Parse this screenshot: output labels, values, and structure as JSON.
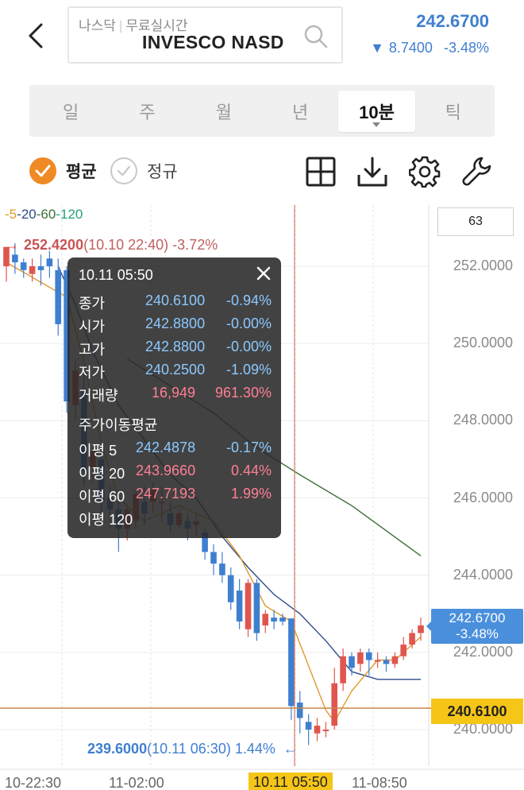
{
  "header": {
    "exchange": "나스닥",
    "realtime": "무료실시간",
    "symbol_name": "INVESCO NASD",
    "price": "242.6700",
    "change_arrow": "▼",
    "change_value": "8.7400",
    "change_percent": "-3.48%",
    "change_color": "#3f7fd0"
  },
  "tabs": [
    {
      "label": "일",
      "active": false
    },
    {
      "label": "주",
      "active": false
    },
    {
      "label": "월",
      "active": false
    },
    {
      "label": "년",
      "active": false
    },
    {
      "label": "10분",
      "active": true
    },
    {
      "label": "틱",
      "active": false
    }
  ],
  "toolbar": {
    "average_label": "평균",
    "average_checked": true,
    "regular_label": "정규",
    "regular_checked": false,
    "icons": [
      "grid-icon",
      "download-icon",
      "settings-icon",
      "wrench-icon"
    ],
    "accent_color": "#f08a24"
  },
  "chart": {
    "ma_legend": {
      "dash": "-",
      "ma5": "5",
      "ma20": "20",
      "ma60": "60",
      "ma120": "120"
    },
    "count": "63",
    "high_label": {
      "arrow": "→",
      "value": "252.4200",
      "time": "(10.10 22:40)",
      "percent": "-3.72%"
    },
    "low_label": {
      "value": "239.6000",
      "time": "(10.11 06:30)",
      "percent": "1.44%",
      "arrow": "←"
    },
    "y_axis": [
      "252.0000",
      "250.0000",
      "248.0000",
      "246.0000",
      "244.0000",
      "242.0000",
      "240.0000"
    ],
    "current_price_tag": {
      "price": "242.6700",
      "percent": "-3.48%"
    },
    "crosshair_price": "240.6100",
    "x_axis": [
      "10-22:30",
      "11-02:00",
      "10.11 05:50",
      "11-08:50"
    ]
  },
  "tooltip": {
    "datetime": "10.11 05:50",
    "rows": [
      {
        "key": "종가",
        "value": "240.6100",
        "pct": "-0.94%"
      },
      {
        "key": "시가",
        "value": "242.8800",
        "pct": "-0.00%"
      },
      {
        "key": "고가",
        "value": "242.8800",
        "pct": "-0.00%"
      },
      {
        "key": "저가",
        "value": "240.2500",
        "pct": "-1.09%"
      }
    ],
    "volume": {
      "key": "거래량",
      "value": "16,949",
      "pct": "961.30%"
    },
    "ma_section_title": "주가이동평균",
    "ma_rows": [
      {
        "key": "이평 5",
        "value": "242.4878",
        "pct": "-0.17%"
      },
      {
        "key": "이평 20",
        "value": "243.9660",
        "pct": "0.44%"
      },
      {
        "key": "이평 60",
        "value": "247.7193",
        "pct": "1.99%"
      },
      {
        "key": "이평 120",
        "value": "",
        "pct": ""
      }
    ]
  },
  "chart_data": {
    "type": "candlestick",
    "y_range": [
      239.2,
      253.0
    ],
    "x_labels": [
      "10-22:30",
      "11-02:00",
      "10.11 05:50",
      "11-08:50"
    ],
    "candles": [
      {
        "o": 252.0,
        "h": 252.5,
        "c": 252.5,
        "l": 251.6
      },
      {
        "o": 252.3,
        "h": 252.6,
        "c": 252.1,
        "l": 251.8
      },
      {
        "o": 252.1,
        "h": 252.2,
        "c": 251.9,
        "l": 251.7
      },
      {
        "o": 251.8,
        "h": 252.2,
        "c": 252.0,
        "l": 251.6
      },
      {
        "o": 252.0,
        "h": 252.3,
        "c": 251.9,
        "l": 251.5
      },
      {
        "o": 252.2,
        "h": 252.4,
        "c": 252.0,
        "l": 251.7
      },
      {
        "o": 251.9,
        "h": 252.2,
        "c": 250.5,
        "l": 250.2
      },
      {
        "o": 251.9,
        "h": 252.0,
        "c": 248.5,
        "l": 248.2
      },
      {
        "o": 248.4,
        "h": 249.6,
        "c": 249.3,
        "l": 248.0
      },
      {
        "o": 248.8,
        "h": 249.2,
        "c": 246.7,
        "l": 246.3
      },
      {
        "o": 246.8,
        "h": 247.3,
        "c": 247.2,
        "l": 246.4
      },
      {
        "o": 247.0,
        "h": 247.3,
        "c": 245.9,
        "l": 245.5
      },
      {
        "o": 246.0,
        "h": 246.3,
        "c": 245.7,
        "l": 245.2
      },
      {
        "o": 245.7,
        "h": 246.0,
        "c": 245.2,
        "l": 244.6
      },
      {
        "o": 245.2,
        "h": 245.8,
        "c": 245.7,
        "l": 244.9
      },
      {
        "o": 245.4,
        "h": 246.2,
        "c": 246.1,
        "l": 245.2
      },
      {
        "o": 245.9,
        "h": 246.3,
        "c": 245.6,
        "l": 245.3
      },
      {
        "o": 245.9,
        "h": 246.4,
        "c": 246.2,
        "l": 245.6
      },
      {
        "o": 245.9,
        "h": 246.3,
        "c": 245.9,
        "l": 245.4
      },
      {
        "o": 245.6,
        "h": 245.9,
        "c": 245.3,
        "l": 245.1
      },
      {
        "o": 245.3,
        "h": 245.7,
        "c": 245.6,
        "l": 245.2
      },
      {
        "o": 245.4,
        "h": 245.6,
        "c": 245.2,
        "l": 244.9
      },
      {
        "o": 245.3,
        "h": 245.6,
        "c": 245.4,
        "l": 245.0
      },
      {
        "o": 245.1,
        "h": 245.2,
        "c": 244.6,
        "l": 244.4
      },
      {
        "o": 244.6,
        "h": 244.8,
        "c": 244.3,
        "l": 244.0
      },
      {
        "o": 244.3,
        "h": 244.6,
        "c": 244.0,
        "l": 243.8
      },
      {
        "o": 244.0,
        "h": 244.2,
        "c": 243.3,
        "l": 243.1
      },
      {
        "o": 243.6,
        "h": 243.9,
        "c": 242.8,
        "l": 242.6
      },
      {
        "o": 242.6,
        "h": 243.9,
        "c": 243.8,
        "l": 242.4
      },
      {
        "o": 243.8,
        "h": 243.9,
        "c": 242.5,
        "l": 242.3
      },
      {
        "o": 242.7,
        "h": 243.1,
        "c": 243.0,
        "l": 242.5
      },
      {
        "o": 242.9,
        "h": 243.1,
        "c": 242.8,
        "l": 242.6
      },
      {
        "o": 242.9,
        "h": 243.0,
        "c": 242.8,
        "l": 242.7
      },
      {
        "o": 242.88,
        "h": 242.88,
        "c": 240.61,
        "l": 240.25
      },
      {
        "o": 240.7,
        "h": 241.0,
        "c": 240.3,
        "l": 239.9
      },
      {
        "o": 240.2,
        "h": 240.4,
        "c": 240.0,
        "l": 239.6
      },
      {
        "o": 239.9,
        "h": 240.3,
        "c": 240.1,
        "l": 239.7
      },
      {
        "o": 240.0,
        "h": 240.2,
        "c": 240.0,
        "l": 239.8
      },
      {
        "o": 240.1,
        "h": 241.6,
        "c": 241.2,
        "l": 240.0
      },
      {
        "o": 241.2,
        "h": 242.1,
        "c": 241.9,
        "l": 241.0
      },
      {
        "o": 241.9,
        "h": 242.0,
        "c": 241.6,
        "l": 241.4
      },
      {
        "o": 241.7,
        "h": 242.1,
        "c": 242.0,
        "l": 241.5
      },
      {
        "o": 242.0,
        "h": 242.1,
        "c": 241.8,
        "l": 241.4
      },
      {
        "o": 241.8,
        "h": 242.0,
        "c": 241.8,
        "l": 241.6
      },
      {
        "o": 241.8,
        "h": 241.9,
        "c": 241.7,
        "l": 241.5
      },
      {
        "o": 241.7,
        "h": 242.0,
        "c": 241.9,
        "l": 241.6
      },
      {
        "o": 241.9,
        "h": 242.4,
        "c": 242.2,
        "l": 241.8
      },
      {
        "o": 242.2,
        "h": 242.6,
        "c": 242.5,
        "l": 242.1
      },
      {
        "o": 242.5,
        "h": 242.9,
        "c": 242.7,
        "l": 242.3
      }
    ],
    "ma5": [
      [
        252.1,
        0
      ],
      [
        251.2,
        7
      ],
      [
        249.5,
        9
      ],
      [
        247.4,
        11
      ],
      [
        246.0,
        13
      ],
      [
        245.4,
        16
      ],
      [
        245.8,
        20
      ],
      [
        245.4,
        24
      ],
      [
        244.5,
        27
      ],
      [
        243.2,
        30
      ],
      [
        242.8,
        33
      ],
      [
        240.5,
        37
      ],
      [
        240.2,
        38
      ],
      [
        241.0,
        40
      ],
      [
        241.8,
        43
      ],
      [
        241.8,
        45
      ],
      [
        242.4,
        48
      ]
    ],
    "ma20": [
      [
        252.0,
        6
      ],
      [
        251.0,
        8
      ],
      [
        249.8,
        10
      ],
      [
        248.4,
        13
      ],
      [
        247.5,
        16
      ],
      [
        246.6,
        19
      ],
      [
        246.0,
        22
      ],
      [
        245.0,
        25
      ],
      [
        244.2,
        28
      ],
      [
        243.5,
        31
      ],
      [
        243.0,
        34
      ],
      [
        242.3,
        37
      ],
      [
        241.5,
        40
      ],
      [
        241.3,
        43
      ],
      [
        241.3,
        46
      ],
      [
        241.3,
        48
      ]
    ],
    "ma60": [
      [
        249.6,
        14
      ],
      [
        248.2,
        24
      ],
      [
        247.3,
        29
      ],
      [
        246.6,
        34
      ],
      [
        245.8,
        40
      ],
      [
        244.5,
        48
      ]
    ],
    "ma_colors": {
      "ma5": "#e09a2c",
      "ma20": "#2d4c8a",
      "ma60": "#3c6e3a"
    },
    "up_color": "#e0564e",
    "down_color": "#3f7fd0"
  }
}
